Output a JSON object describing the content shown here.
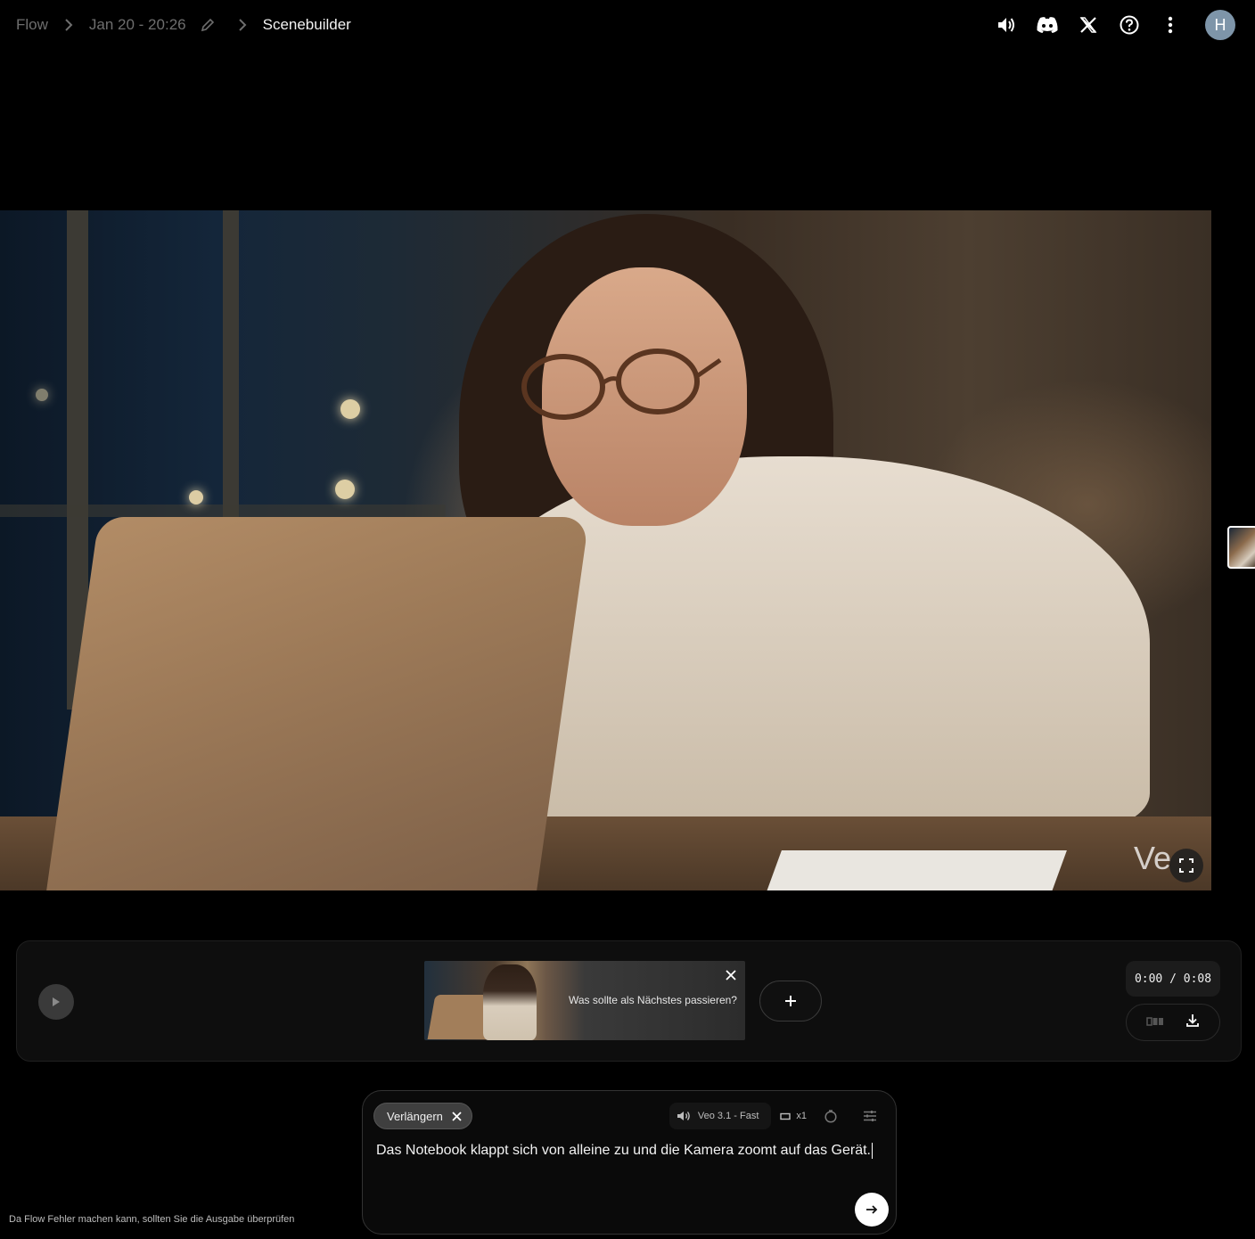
{
  "breadcrumb": {
    "root": "Flow",
    "project": "Jan 20 - 20:26",
    "current": "Scenebuilder"
  },
  "header": {
    "avatar_initial": "H",
    "icons": [
      "volume-icon",
      "discord-icon",
      "x-icon",
      "help-icon",
      "more-vert-icon"
    ]
  },
  "video": {
    "watermark": "Ve"
  },
  "timeline": {
    "clip_prompt": "Was sollte als Nächstes passieren?",
    "time_display": "0:00 / 0:08"
  },
  "prompt": {
    "chip_label": "Verlängern",
    "model_label": "Veo 3.1 - Fast",
    "count_label": "x1",
    "text": "Das Notebook klappt sich von alleine zu und die Kamera zoomt auf das Gerät."
  },
  "footer": {
    "disclaimer": "Da Flow Fehler machen kann, sollten Sie die Ausgabe überprüfen"
  },
  "colors": {
    "background": "#000000",
    "panel": "#0e0e0e",
    "avatar": "#7e95a9",
    "muted_text": "#6e6e6e"
  }
}
